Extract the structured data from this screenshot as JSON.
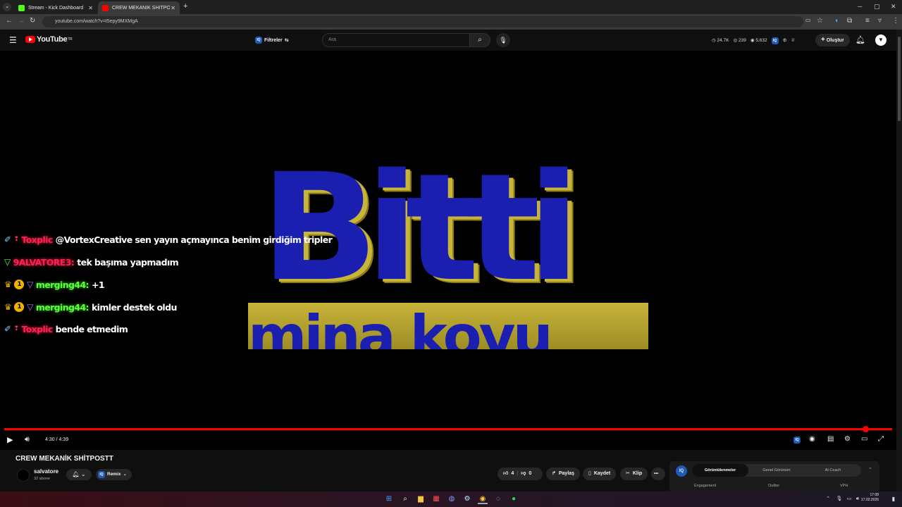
{
  "browser": {
    "tabs": [
      {
        "label": "Stream - Kick Dashboard",
        "close": "✕"
      },
      {
        "label": "CREW MEKANİK SHİTPOSTT - Y",
        "close": "✕"
      }
    ],
    "new_tab": "+",
    "url": "youtube.com/watch?v=t5epy9MXMgA",
    "window_controls": [
      "─",
      "▢",
      "✕"
    ]
  },
  "youtube": {
    "logo_text": "YouTube",
    "logo_region": "TR",
    "filters_label": "Filtreler",
    "search_placeholder": "Ara",
    "stats": [
      "24.7K",
      "239",
      "5,632"
    ],
    "create_label": "Oluştur"
  },
  "chat": [
    {
      "user": "Toxplic",
      "message": "@VortexCreative sen yayın açmayınca benim girdiğim tripler",
      "user_color": "red"
    },
    {
      "user": "9ALVATORE3:",
      "message": "tek başıma yapmadım",
      "user_color": "red"
    },
    {
      "user": "merging44:",
      "message": "+1",
      "user_color": "green"
    },
    {
      "user": "merging44:",
      "message": "kimler destek oldu",
      "user_color": "green"
    },
    {
      "user": "Toxplic",
      "message": "bende etmedim",
      "user_color": "red"
    }
  ],
  "video": {
    "frame_line1": "Bitti",
    "frame_line2": "mina koyu",
    "time": "4:30 / 4:39",
    "progress_fraction": 0.969
  },
  "below": {
    "title": "CREW MEKANİK SHİTPOSTT",
    "channel": "salvatore",
    "subscribers": "32 abone",
    "remix": "Remix",
    "likes": "4",
    "dislikes": "0",
    "share": "Paylaş",
    "save": "Kaydet",
    "clip": "Klip",
    "more": "•••"
  },
  "panel": {
    "badge": "IQ",
    "tabs": [
      "Görüntülenmeler",
      "Genel Görünüm",
      "AI Coach"
    ],
    "labels": [
      "Engagement",
      "Outlier",
      "VPH"
    ]
  },
  "taskbar": {
    "time": "17:08",
    "date": "17.02.2026"
  },
  "colors": {
    "accent_red": "#ff0000",
    "chat_red": "#ff2050",
    "chat_green": "#5cff3a"
  }
}
